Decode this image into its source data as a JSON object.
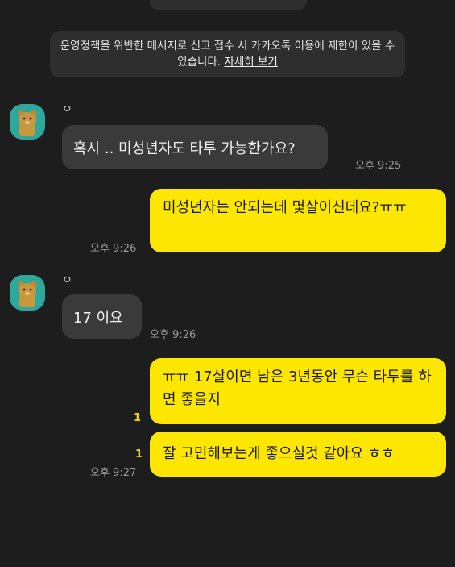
{
  "notice": {
    "text": "운영정책을 위반한 메시지로 신고 접수 시 카카오톡 이용에 제한이 있을 수 있습니다.",
    "link_label": "자세히 보기"
  },
  "sender": {
    "name": "ㅇ"
  },
  "messages": [
    {
      "direction": "in",
      "text": "혹시 .. 미성년자도 타투 가능한가요?",
      "time": "오후 9:25"
    },
    {
      "direction": "out",
      "text": "미성년자는 안되는데 몇살이신데요?ㅠㅠ",
      "time": "오후 9:26"
    },
    {
      "direction": "in",
      "text": "17 이요",
      "time": "오후 9:26"
    },
    {
      "direction": "out",
      "text": "ㅠㅠ 17살이면 남은 3년동안 무슨 타투를 하면 좋을지",
      "unread": "1"
    },
    {
      "direction": "out",
      "text": "잘 고민해보는게 좋으실것 같아요 ㅎㅎ",
      "unread": "1",
      "time": "오후 9:27"
    }
  ],
  "colors": {
    "background": "#1d1d1d",
    "incoming_bubble": "#3a3a3a",
    "outgoing_bubble": "#fde700",
    "avatar_bg": "#2ea89c",
    "unread": "#f2da00"
  }
}
